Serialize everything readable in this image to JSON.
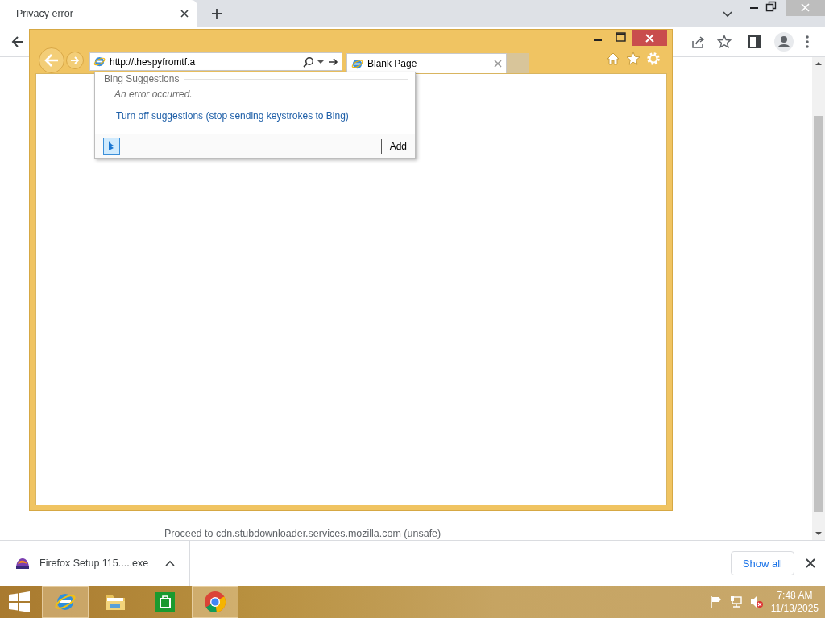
{
  "chrome_window": {
    "tab": {
      "title": "Privacy error",
      "selected": true
    },
    "page": {
      "proceed_link": "Proceed to cdn.stubdownloader.services.mozilla.com (unsafe)"
    },
    "download_bar": {
      "file": "Firefox Setup 115.....exe",
      "show_all": "Show all"
    }
  },
  "ie_window": {
    "address": "http://thespyfromtf.a",
    "tabs": [
      {
        "title": "Blank Page",
        "selected": true
      }
    ],
    "suggestions": {
      "heading": "Bing Suggestions",
      "message": "An error occurred.",
      "turn_off_link": "Turn off suggestions (stop sending keystrokes to Bing)",
      "add_button": "Add"
    }
  },
  "taskbar": {
    "apps": [
      {
        "kind": "ie",
        "selected": true
      },
      {
        "kind": "explorer",
        "selected": false
      },
      {
        "kind": "store",
        "selected": false
      },
      {
        "kind": "chrome",
        "selected": true
      }
    ],
    "clock": {
      "time": "7:48 AM",
      "date": "11/13/2025"
    }
  }
}
